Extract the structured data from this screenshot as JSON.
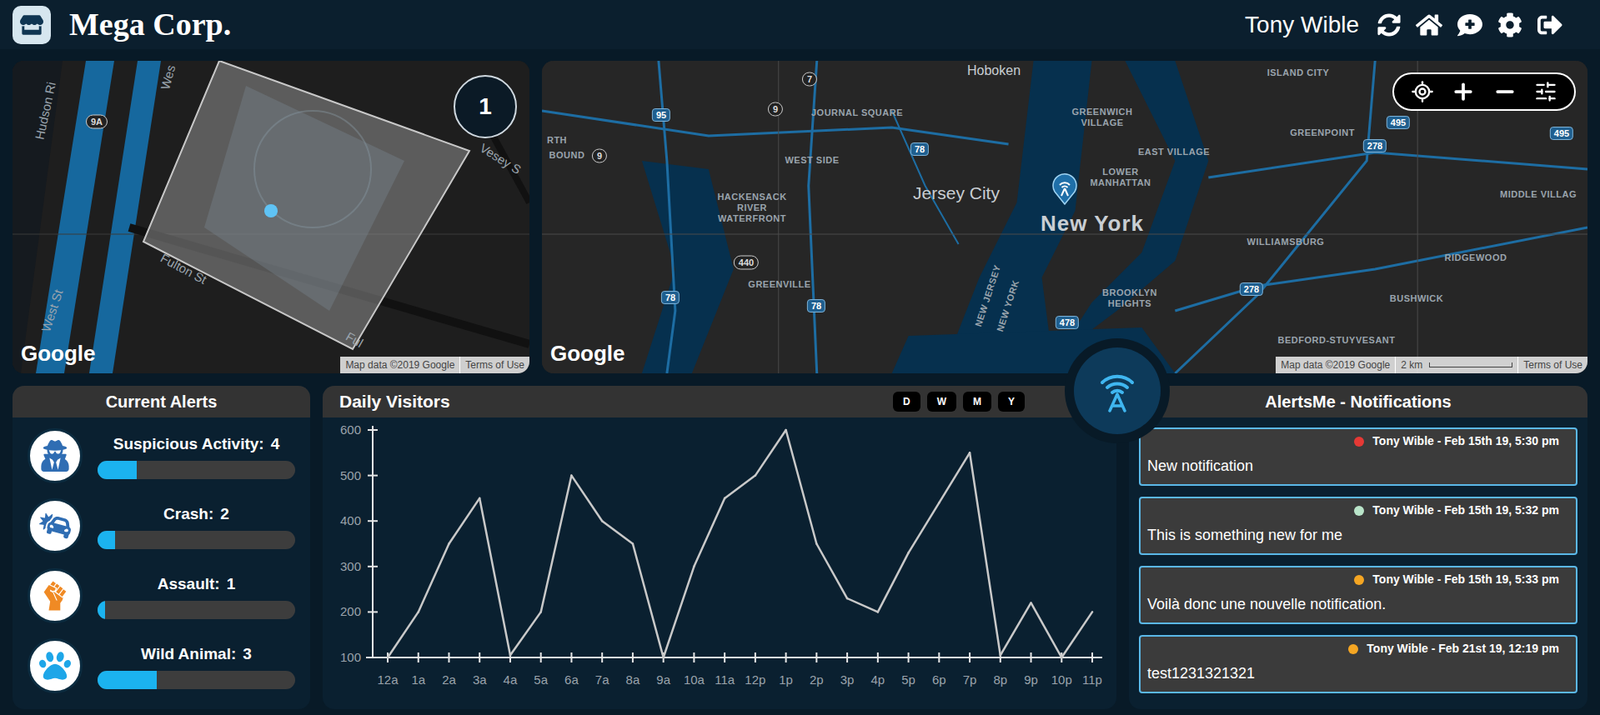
{
  "header": {
    "title": "Mega Corp.",
    "user": "Tony Wible"
  },
  "area_map": {
    "badge": "1",
    "logo": "Google",
    "attribution": "Map data ©2019 Google",
    "terms": "Terms of Use",
    "labels": [
      {
        "text": "Hudson Ri",
        "kind": "road"
      },
      {
        "text": "9A",
        "kind": "shield"
      },
      {
        "text": "Wes",
        "kind": "road"
      },
      {
        "text": "Vesey S",
        "kind": "road"
      },
      {
        "text": "Fulton St",
        "kind": "road"
      },
      {
        "text": "West St",
        "kind": "road"
      },
      {
        "text": "Ful",
        "kind": "road"
      }
    ]
  },
  "city_map": {
    "logo": "Google",
    "attribution": "Map data ©2019 Google",
    "scale": "2 km",
    "terms": "Terms of Use",
    "labels": [
      {
        "text": "Hoboken",
        "kind": "town"
      },
      {
        "text": "7",
        "kind": "shield"
      },
      {
        "text": "95",
        "kind": "interstate"
      },
      {
        "text": "9",
        "kind": "shield"
      },
      {
        "text": "JOURNAL SQUARE",
        "kind": "area"
      },
      {
        "text": "RTH",
        "kind": "area"
      },
      {
        "text": "BOUND",
        "kind": "area"
      },
      {
        "text": "9",
        "kind": "shield"
      },
      {
        "text": "WEST SIDE",
        "kind": "area"
      },
      {
        "text": "78",
        "kind": "interstate"
      },
      {
        "text": "HACKENSACK RIVER WATERFRONT",
        "kind": "area"
      },
      {
        "text": "Jersey City",
        "kind": "city"
      },
      {
        "text": "New York",
        "kind": "metro"
      },
      {
        "text": "GREENWICH VILLAGE",
        "kind": "area"
      },
      {
        "text": "LOWER MANHATTAN",
        "kind": "area"
      },
      {
        "text": "EAST VILLAGE",
        "kind": "area"
      },
      {
        "text": "ISLAND CITY",
        "kind": "area"
      },
      {
        "text": "GREENPOINT",
        "kind": "area"
      },
      {
        "text": "278",
        "kind": "interstate"
      },
      {
        "text": "495",
        "kind": "interstate"
      },
      {
        "text": "495",
        "kind": "interstate"
      },
      {
        "text": "MIDDLE VILLAG",
        "kind": "area"
      },
      {
        "text": "WILLIAMSBURG",
        "kind": "area"
      },
      {
        "text": "RIDGEWOOD",
        "kind": "area"
      },
      {
        "text": "440",
        "kind": "shield"
      },
      {
        "text": "GREENVILLE",
        "kind": "area"
      },
      {
        "text": "78",
        "kind": "interstate"
      },
      {
        "text": "78",
        "kind": "interstate"
      },
      {
        "text": "NEW JERSEY",
        "kind": "area"
      },
      {
        "text": "NEW YORK",
        "kind": "area"
      },
      {
        "text": "278",
        "kind": "interstate"
      },
      {
        "text": "BROOKLYN HEIGHTS",
        "kind": "area"
      },
      {
        "text": "BUSHWICK",
        "kind": "area"
      },
      {
        "text": "478",
        "kind": "interstate"
      },
      {
        "text": "BEDFORD-STUYVESANT",
        "kind": "area"
      }
    ]
  },
  "alerts": {
    "title": "Current Alerts",
    "items": [
      {
        "label": "Suspicious Activity:",
        "count": "4",
        "level": 0.2,
        "color": "#2f6db3"
      },
      {
        "label": "Crash:",
        "count": "2",
        "level": 0.09,
        "color": "#2f6db3"
      },
      {
        "label": "Assault:",
        "count": "1",
        "level": 0.04,
        "color": "#f08a24"
      },
      {
        "label": "Wild Animal:",
        "count": "3",
        "level": 0.3,
        "color": "#1ea6e8"
      }
    ]
  },
  "visitors": {
    "title": "Daily Visitors",
    "ranges": [
      {
        "label": "D",
        "selected": false
      },
      {
        "label": "W",
        "selected": false
      },
      {
        "label": "M",
        "selected": false
      },
      {
        "label": "Y",
        "selected": false
      }
    ],
    "y_ticks": [
      "600",
      "500",
      "400",
      "300",
      "200",
      "100"
    ],
    "x_ticks": [
      "12a",
      "1a",
      "2a",
      "3a",
      "4a",
      "5a",
      "6a",
      "7a",
      "8a",
      "9a",
      "10a",
      "11a",
      "12p",
      "1p",
      "2p",
      "3p",
      "4p",
      "5p",
      "6p",
      "7p",
      "8p",
      "9p",
      "10p",
      "11p"
    ],
    "series": [
      {
        "name": "visitors",
        "values": [
          100,
          200,
          350,
          450,
          105,
          200,
          500,
          400,
          350,
          100,
          300,
          450,
          500,
          600,
          350,
          230,
          200,
          330,
          440,
          550,
          105,
          220,
          100,
          200
        ]
      }
    ]
  },
  "notifications": {
    "title": "AlertsMe - Notifications",
    "items": [
      {
        "meta": "Tony Wible - Feb 15th 19, 5:30 pm",
        "text": "New notification",
        "color": "#e53935"
      },
      {
        "meta": "Tony Wible - Feb 15th 19, 5:32 pm",
        "text": "This is something new for me",
        "color": "#b9e4c9"
      },
      {
        "meta": "Tony Wible - Feb 15th 19, 5:33 pm",
        "text": "Voilà donc une nouvelle notification.",
        "color": "#f5a623"
      },
      {
        "meta": "Tony Wible - Feb 21st 19, 12:19 pm",
        "text": "test1231321321",
        "color": "#f5a623"
      }
    ]
  }
}
